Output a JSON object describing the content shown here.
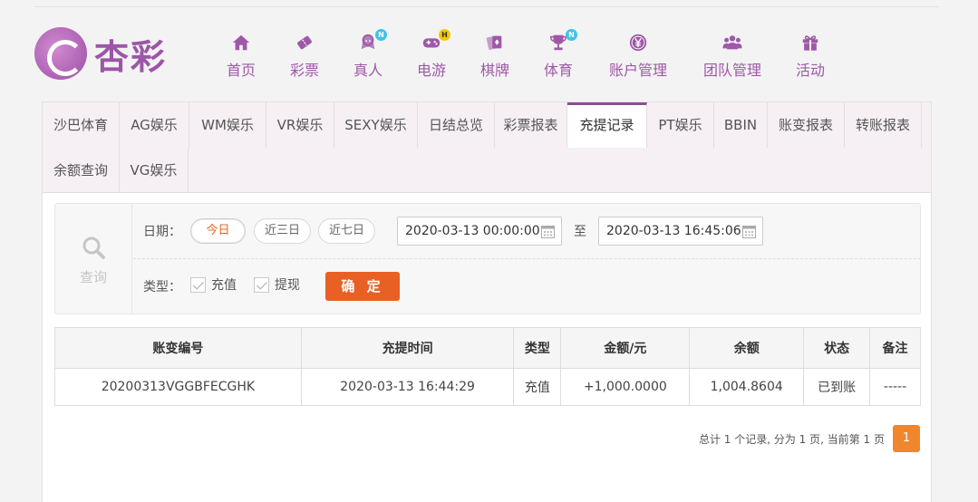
{
  "logo": {
    "text": "杏彩"
  },
  "nav": [
    {
      "label": "首页",
      "icon": "home-icon",
      "badge": ""
    },
    {
      "label": "彩票",
      "icon": "ticket-icon",
      "badge": ""
    },
    {
      "label": "真人",
      "icon": "live-dealer-icon",
      "badge": "N"
    },
    {
      "label": "电游",
      "icon": "gamepad-icon",
      "badge": "H"
    },
    {
      "label": "棋牌",
      "icon": "cards-icon",
      "badge": ""
    },
    {
      "label": "体育",
      "icon": "trophy-icon",
      "badge": "N"
    },
    {
      "label": "账户管理",
      "icon": "yen-coin-icon",
      "badge": ""
    },
    {
      "label": "团队管理",
      "icon": "team-icon",
      "badge": ""
    },
    {
      "label": "活动",
      "icon": "gift-icon",
      "badge": ""
    }
  ],
  "tabs": [
    "沙巴体育",
    "AG娱乐",
    "WM娱乐",
    "VR娱乐",
    "SEXY娱乐",
    "日结总览",
    "彩票报表",
    "充提记录",
    "PT娱乐",
    "BBIN",
    "账变报表",
    "转账报表",
    "余额查询",
    "VG娱乐"
  ],
  "active_tab": "充提记录",
  "filter": {
    "search_label": "查询",
    "date_label": "日期：",
    "quick_ranges": [
      "今日",
      "近三日",
      "近七日"
    ],
    "active_range": "今日",
    "start": "2020-03-13 00:00:00",
    "to_label": "至",
    "end": "2020-03-13 16:45:06",
    "type_label": "类型：",
    "types": [
      {
        "label": "充值",
        "checked": true
      },
      {
        "label": "提现",
        "checked": true
      }
    ],
    "confirm_label": "确 定"
  },
  "table": {
    "headers": [
      "账变编号",
      "充提时间",
      "类型",
      "金额/元",
      "余额",
      "状态",
      "备注"
    ],
    "rows": [
      [
        "20200313VGGBFECGHK",
        "2020-03-13 16:44:29",
        "充值",
        "+1,000.0000",
        "1,004.8604",
        "已到账",
        "-----"
      ]
    ]
  },
  "pager": {
    "summary": "总计 1 个记录, 分为 1 页, 当前第 1 页",
    "current_page": "1"
  },
  "colors": {
    "brand_purple": "#9f58a8",
    "accent_orange": "#e86024",
    "amount_red": "#c40d1e",
    "status_green": "#3b9b2f"
  }
}
